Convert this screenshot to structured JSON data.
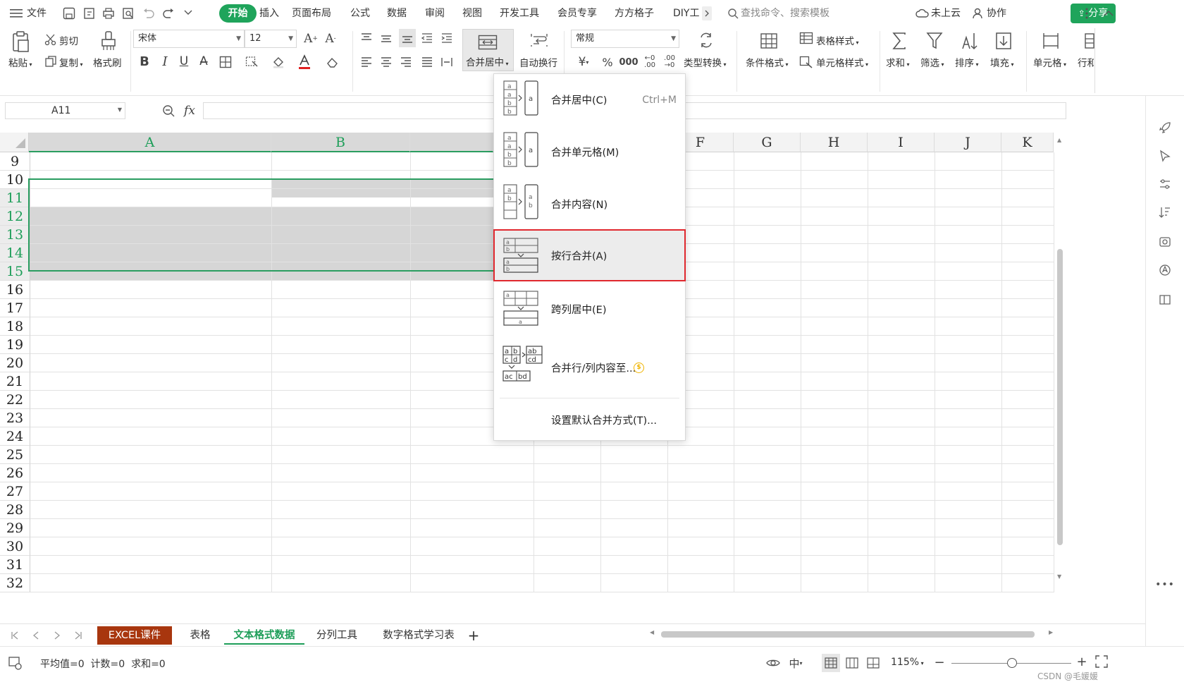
{
  "menubar": {
    "file": "文件",
    "tabs": [
      "开始",
      "插入",
      "页面布局",
      "公式",
      "数据",
      "审阅",
      "视图",
      "开发工具",
      "会员专享",
      "方方格子",
      "DIY工"
    ],
    "search_placeholder": "查找命令、搜索模板",
    "cloud": "未上云",
    "collab": "协作",
    "share": "分享"
  },
  "ribbon": {
    "paste": "粘贴",
    "cut": "剪切",
    "copy": "复制",
    "format_painter": "格式刷",
    "font_name": "宋体",
    "font_size": "12",
    "merge_center": "合并居中",
    "auto_wrap": "自动换行",
    "number_format": "常规",
    "type_convert": "类型转换",
    "cond_format": "条件格式",
    "table_style": "表格样式",
    "cell_style": "单元格样式",
    "sum": "求和",
    "filter": "筛选",
    "sort": "排序",
    "fill": "填充",
    "cell": "单元格",
    "row_col": "行和"
  },
  "formula_bar": {
    "name_box": "A11",
    "fx": "fx",
    "value": ""
  },
  "grid": {
    "columns": [
      "A",
      "B",
      "F",
      "G",
      "H",
      "I",
      "J",
      "K"
    ],
    "rows": [
      "9",
      "10",
      "11",
      "12",
      "13",
      "14",
      "15",
      "16",
      "17",
      "18",
      "19",
      "20",
      "21",
      "22",
      "23",
      "24",
      "25",
      "26",
      "27",
      "28",
      "29",
      "30",
      "31",
      "32"
    ],
    "selected_rows": [
      "11",
      "12",
      "13",
      "14",
      "15"
    ]
  },
  "merge_menu": {
    "items": [
      {
        "label": "合并居中(C)",
        "shortcut": "Ctrl+M"
      },
      {
        "label": "合并单元格(M)",
        "shortcut": ""
      },
      {
        "label": "合并内容(N)",
        "shortcut": ""
      },
      {
        "label": "按行合并(A)",
        "shortcut": ""
      },
      {
        "label": "跨列居中(E)",
        "shortcut": ""
      },
      {
        "label": "合并行/列内容至...",
        "shortcut": ""
      }
    ],
    "default_setting": "设置默认合并方式(T)...",
    "highlighted_index": 3
  },
  "sheets": {
    "tabs": [
      "EXCEL课件",
      "表格",
      "文本格式数据",
      "分列工具",
      "数字格式学习表"
    ],
    "active": "文本格式数据",
    "add": "+"
  },
  "status": {
    "stats": "平均值=0  计数=0  求和=0",
    "zoom": "115%",
    "watermark": "CSDN @毛媛媛"
  },
  "colors": {
    "accent": "#1fa45b",
    "highlight_border": "#e0282e",
    "sheet_tab_red": "#b03a12"
  }
}
